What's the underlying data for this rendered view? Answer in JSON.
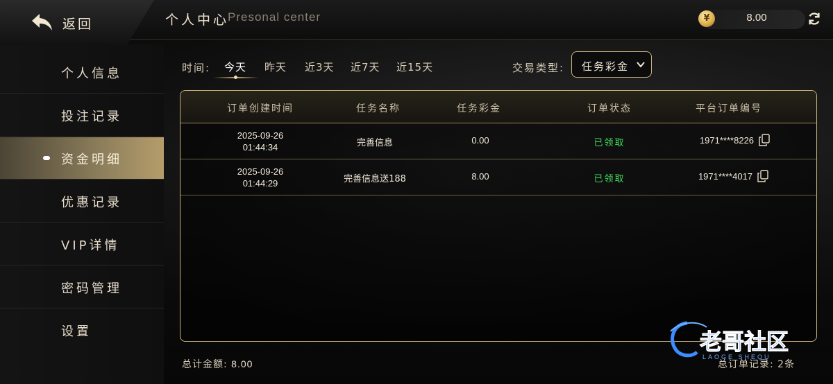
{
  "header": {
    "back_label": "返回",
    "title": "个人中心",
    "title_en": "Presonal center",
    "balance": "8.00",
    "coin_symbol": "¥"
  },
  "sidebar": {
    "items": [
      {
        "label": "个人信息",
        "active": false
      },
      {
        "label": "投注记录",
        "active": false
      },
      {
        "label": "资金明细",
        "active": true
      },
      {
        "label": "优惠记录",
        "active": false
      },
      {
        "label": "VIP详情",
        "active": false
      },
      {
        "label": "密码管理",
        "active": false
      },
      {
        "label": "设置",
        "active": false
      }
    ]
  },
  "filter": {
    "time_label": "时间:",
    "tabs": [
      "今天",
      "昨天",
      "近3天",
      "近7天",
      "近15天"
    ],
    "active_tab": "今天",
    "type_label": "交易类型:",
    "type_value": "任务彩金"
  },
  "table": {
    "headers": [
      "订单创建时间",
      "任务名称",
      "任务彩金",
      "订单状态",
      "平台订单编号"
    ],
    "rows": [
      {
        "date": "2025-09-26",
        "time": "01:44:34",
        "name": "完善信息",
        "amount": "0.00",
        "status": "已领取",
        "order_no": "1971****8226"
      },
      {
        "date": "2025-09-26",
        "time": "01:44:29",
        "name": "完善信息送188",
        "amount": "8.00",
        "status": "已领取",
        "order_no": "1971****4017"
      }
    ]
  },
  "footer": {
    "total_label": "总计金额:",
    "total_value": "8.00",
    "records_label": "总订单记录:",
    "records_value": "2条"
  },
  "watermark": {
    "text": "老哥社区",
    "sub": "LAOGE SHEQU"
  },
  "colors": {
    "gold": "#cbb27c",
    "status_green": "#3fd85a",
    "active_bg": "#b59d6b"
  }
}
